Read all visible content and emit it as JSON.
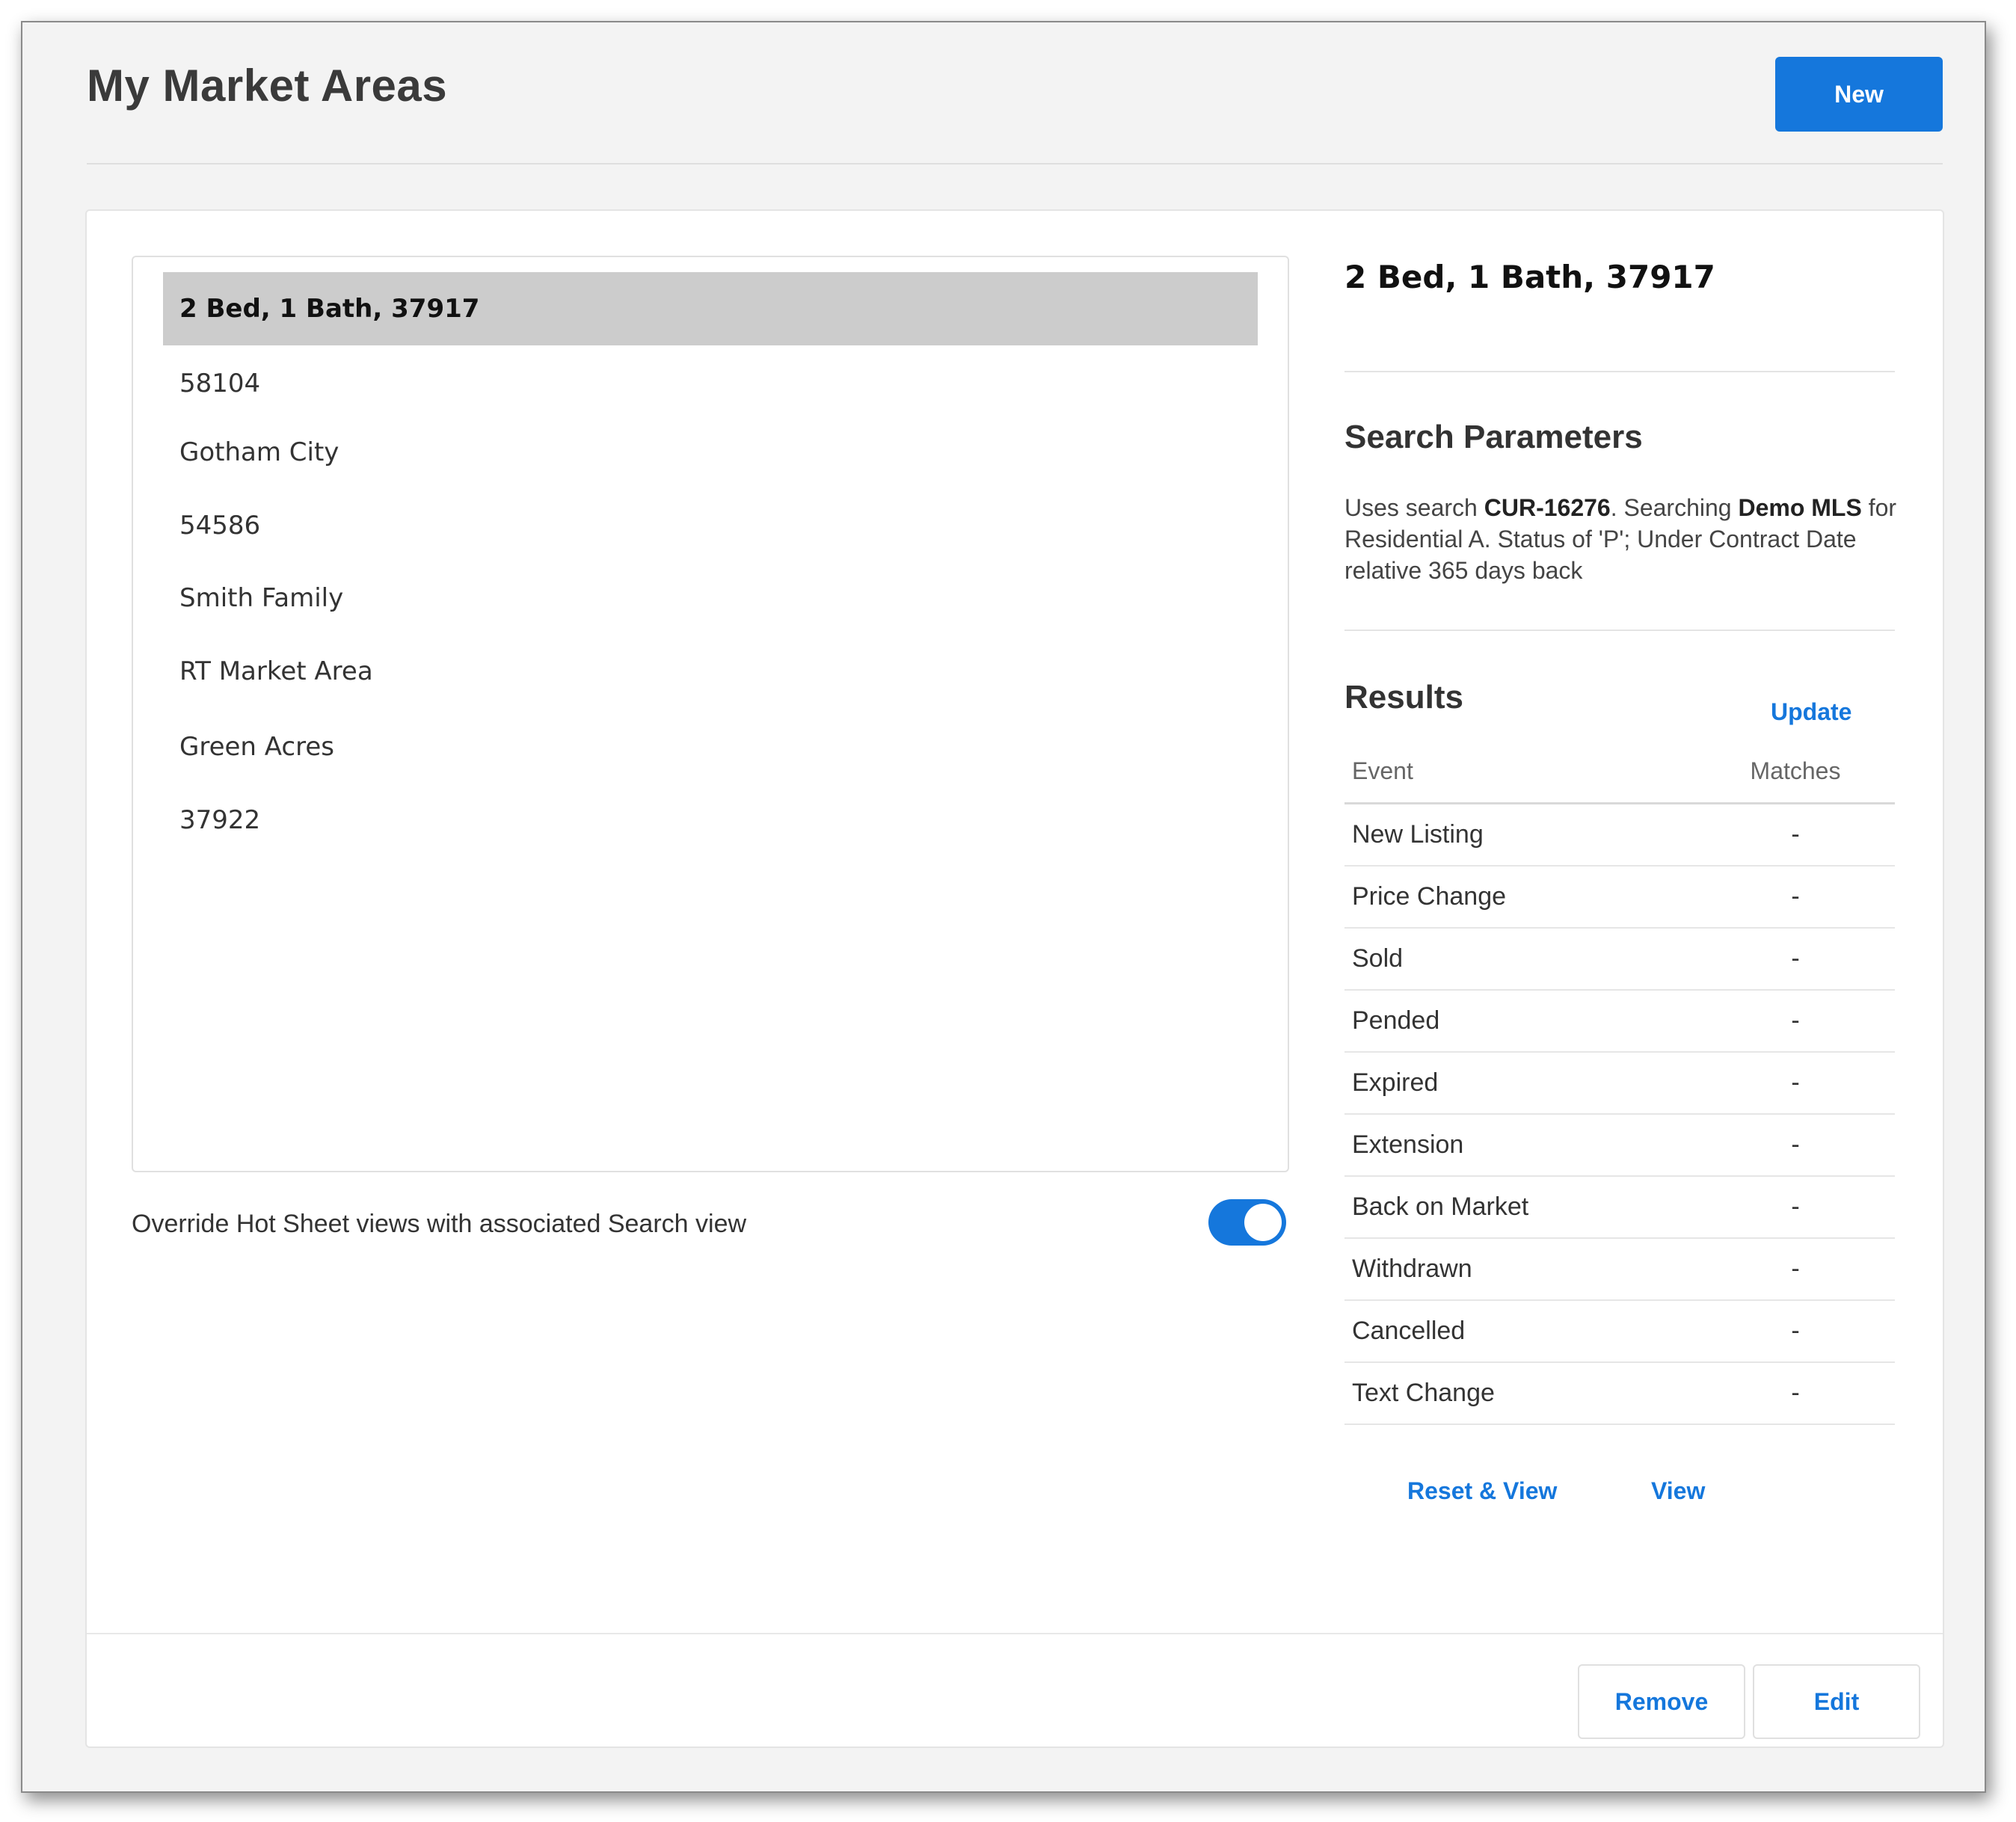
{
  "header": {
    "title": "My Market Areas",
    "new_label": "New"
  },
  "market_areas": {
    "items": [
      {
        "label": "2 Bed, 1 Bath, 37917",
        "selected": true
      },
      {
        "label": "58104"
      },
      {
        "label": "Gotham City"
      },
      {
        "label": "54586"
      },
      {
        "label": "Smith Family"
      },
      {
        "label": "RT Market Area"
      },
      {
        "label": "Green Acres"
      },
      {
        "label": "37922"
      }
    ]
  },
  "override": {
    "label": "Override Hot Sheet views with associated Search view",
    "enabled": true
  },
  "detail": {
    "title": "2 Bed, 1 Bath, 37917",
    "search_parameters": {
      "heading": "Search Parameters",
      "prefix": "Uses search ",
      "search_id": "CUR-16276",
      "middle": ". Searching ",
      "mls": "Demo MLS",
      "suffix": " for Residential A. Status of 'P'; Under Contract Date relative 365 days back"
    },
    "results": {
      "heading": "Results",
      "update_label": "Update",
      "col_event": "Event",
      "col_matches": "Matches",
      "rows": [
        {
          "event": "New Listing",
          "matches": "-"
        },
        {
          "event": "Price Change",
          "matches": "-"
        },
        {
          "event": "Sold",
          "matches": "-"
        },
        {
          "event": "Pended",
          "matches": "-"
        },
        {
          "event": "Expired",
          "matches": "-"
        },
        {
          "event": "Extension",
          "matches": "-"
        },
        {
          "event": "Back on Market",
          "matches": "-"
        },
        {
          "event": "Withdrawn",
          "matches": "-"
        },
        {
          "event": "Cancelled",
          "matches": "-"
        },
        {
          "event": "Text Change",
          "matches": "-"
        }
      ]
    },
    "reset_view_label": "Reset & View",
    "view_label": "View"
  },
  "footer": {
    "remove_label": "Remove",
    "edit_label": "Edit"
  },
  "colors": {
    "accent": "#1577dc",
    "selected_row": "#cccccc",
    "page_bg": "#f3f3f3"
  }
}
